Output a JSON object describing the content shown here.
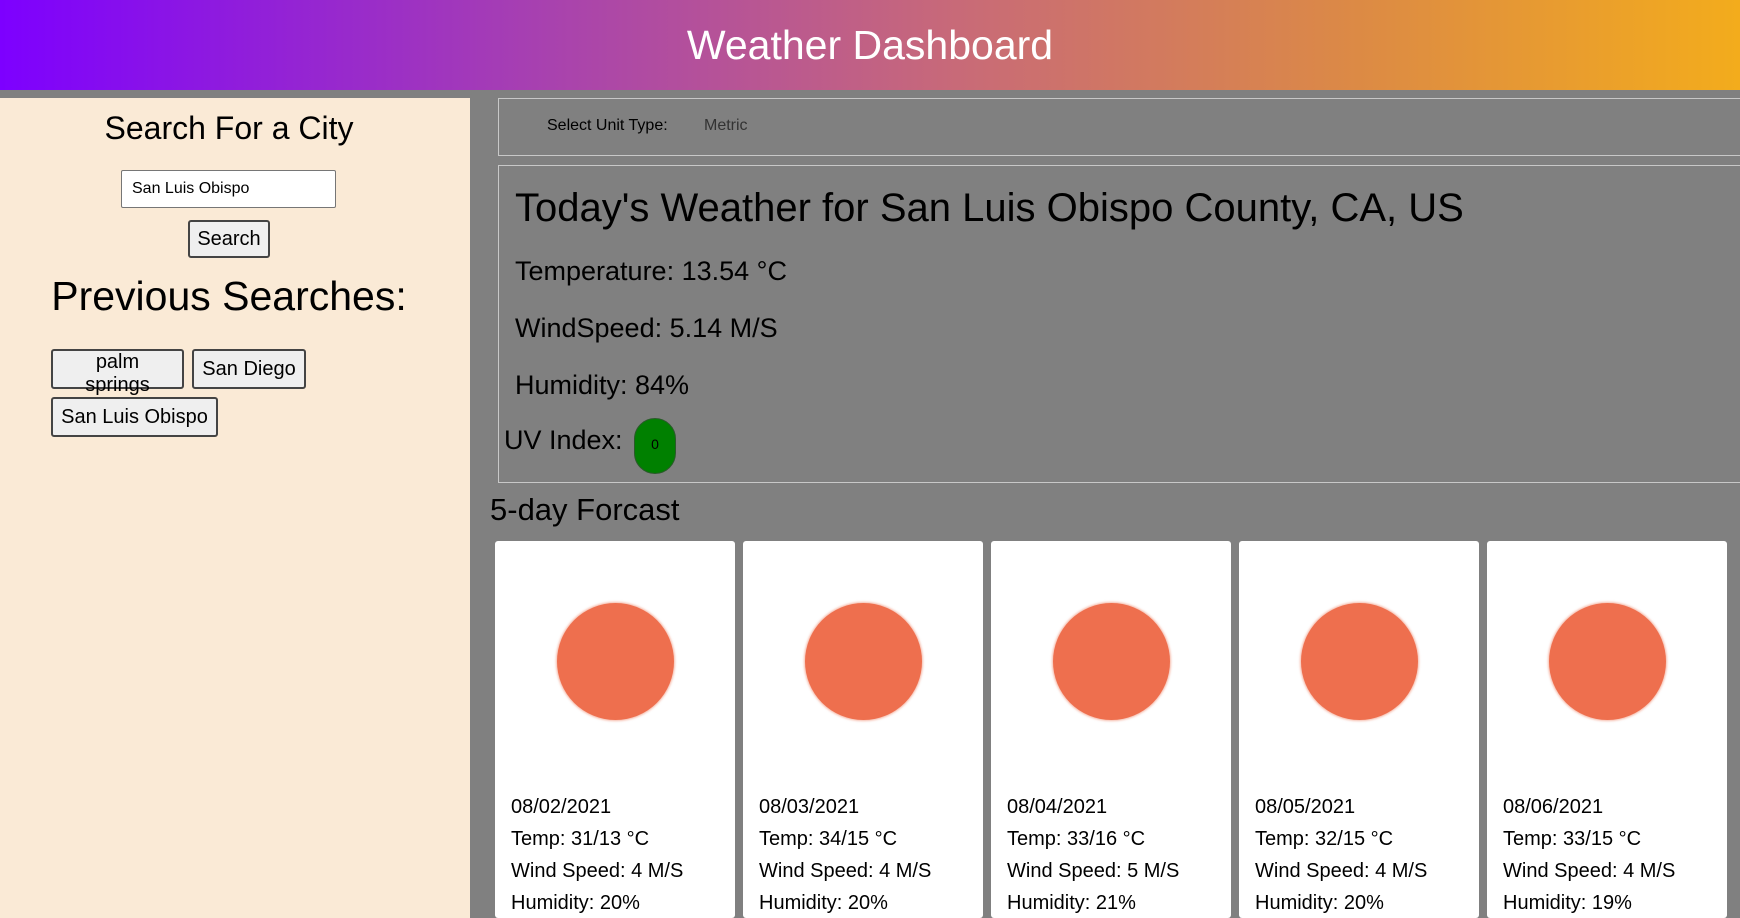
{
  "header": {
    "title": "Weather Dashboard"
  },
  "sidebar": {
    "search_title": "Search For a City",
    "search_input_value": "San Luis Obispo",
    "search_button": "Search",
    "previous_title": "Previous Searches:",
    "history": [
      "palm springs",
      "San Diego",
      "San Luis Obispo"
    ]
  },
  "units": {
    "label": "Select Unit Type:",
    "selected": "Metric"
  },
  "today": {
    "title": "Today's Weather for San Luis Obispo County, CA, US",
    "temperature": "Temperature: 13.54 °C",
    "wind": "WindSpeed: 5.14 M/S",
    "humidity": "Humidity: 84%",
    "uv_label": "UV Index:",
    "uv_value": "0",
    "uv_color": "#008000"
  },
  "forecast": {
    "title": "5-day Forcast",
    "icon": "sun-icon",
    "days": [
      {
        "date": "08/02/2021",
        "temp": "Temp: 31/13 °C",
        "wind": "Wind Speed: 4 M/S",
        "humidity": "Humidity: 20%"
      },
      {
        "date": "08/03/2021",
        "temp": "Temp: 34/15 °C",
        "wind": "Wind Speed: 4 M/S",
        "humidity": "Humidity: 20%"
      },
      {
        "date": "08/04/2021",
        "temp": "Temp: 33/16 °C",
        "wind": "Wind Speed: 5 M/S",
        "humidity": "Humidity: 21%"
      },
      {
        "date": "08/05/2021",
        "temp": "Temp: 32/15 °C",
        "wind": "Wind Speed: 4 M/S",
        "humidity": "Humidity: 20%"
      },
      {
        "date": "08/06/2021",
        "temp": "Temp: 33/15 °C",
        "wind": "Wind Speed: 4 M/S",
        "humidity": "Humidity: 19%"
      }
    ]
  },
  "colors": {
    "sidebar_bg": "#faead6",
    "main_bg": "#808080",
    "sun": "#ee6f4e",
    "header_gradient_start": "#7d00ff",
    "header_gradient_end": "#f3ac1c"
  }
}
